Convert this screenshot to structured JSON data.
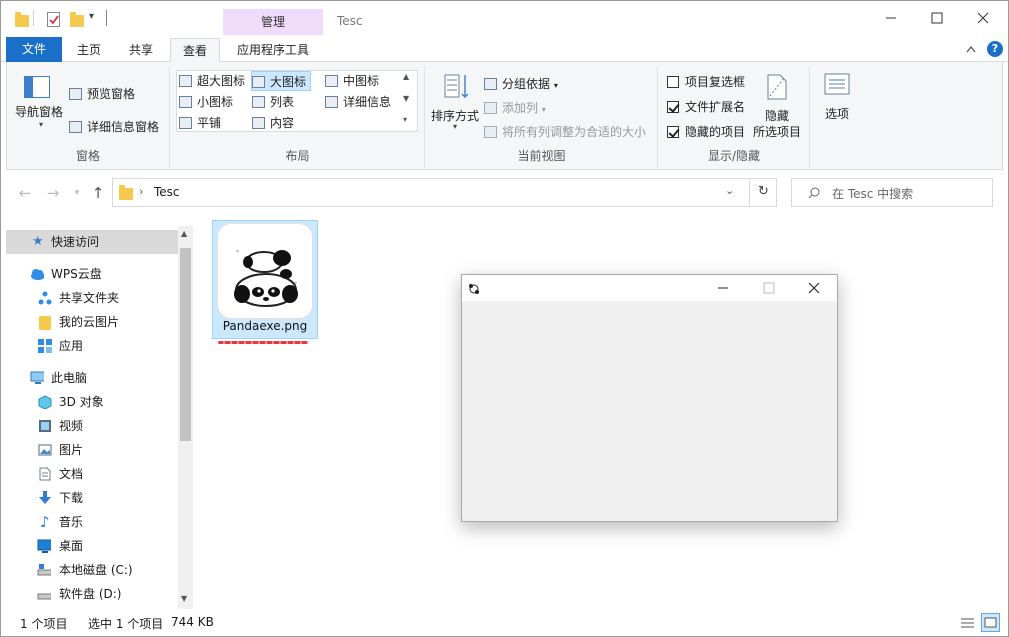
{
  "window": {
    "title": "Tesc",
    "contextual_tab_group": "管理"
  },
  "ribbon": {
    "tabs": [
      "文件",
      "主页",
      "共享",
      "查看",
      "应用程序工具"
    ],
    "active_tab": "查看",
    "panes": {
      "label": "窗格",
      "nav_pane": "导航窗格",
      "preview_pane": "预览窗格",
      "details_pane": "详细信息窗格"
    },
    "layout": {
      "label": "布局",
      "items": [
        "超大图标",
        "大图标",
        "中图标",
        "小图标",
        "列表",
        "详细信息",
        "平铺",
        "内容"
      ],
      "selected": "大图标"
    },
    "current_view": {
      "label": "当前视图",
      "sort_by": "排序方式",
      "group_by": "分组依据",
      "add_columns": "添加列",
      "size_all_columns": "将所有列调整为合适的大小"
    },
    "show_hide": {
      "label": "显示/隐藏",
      "item_checkboxes": "项目复选框",
      "item_checkboxes_checked": false,
      "file_extensions": "文件扩展名",
      "file_extensions_checked": true,
      "hidden_items": "隐藏的项目",
      "hidden_items_checked": true,
      "hide_selected_line1": "隐藏",
      "hide_selected_line2": "所选项目"
    },
    "options": "选项"
  },
  "address": {
    "path": "Tesc",
    "search_placeholder": "在 Tesc 中搜索"
  },
  "nav": {
    "items": [
      {
        "label": "快速访问",
        "icon": "star-icon"
      },
      {
        "label": "WPS云盘",
        "icon": "cloud-icon"
      },
      {
        "label": "共享文件夹",
        "icon": "share-icon"
      },
      {
        "label": "我的云图片",
        "icon": "folder-icon"
      },
      {
        "label": "应用",
        "icon": "apps-icon"
      },
      {
        "label": "此电脑",
        "icon": "computer-icon"
      },
      {
        "label": "3D 对象",
        "icon": "cube-icon"
      },
      {
        "label": "视频",
        "icon": "video-icon"
      },
      {
        "label": "图片",
        "icon": "picture-icon"
      },
      {
        "label": "文档",
        "icon": "document-icon"
      },
      {
        "label": "下载",
        "icon": "download-icon"
      },
      {
        "label": "音乐",
        "icon": "music-icon"
      },
      {
        "label": "桌面",
        "icon": "desktop-icon"
      },
      {
        "label": "本地磁盘 (C:)",
        "icon": "drive-icon"
      },
      {
        "label": "软件盘 (D:)",
        "icon": "drive-icon"
      }
    ]
  },
  "content": {
    "file": {
      "name": "Pandaexe.png",
      "selected": true
    }
  },
  "status": {
    "count": "1 个项目",
    "selected": "选中 1 个项目",
    "size": "744 KB"
  },
  "colors": {
    "accent": "#1a6fc9",
    "contextual": "#f1dbfa",
    "selection": "#cce8ff"
  }
}
